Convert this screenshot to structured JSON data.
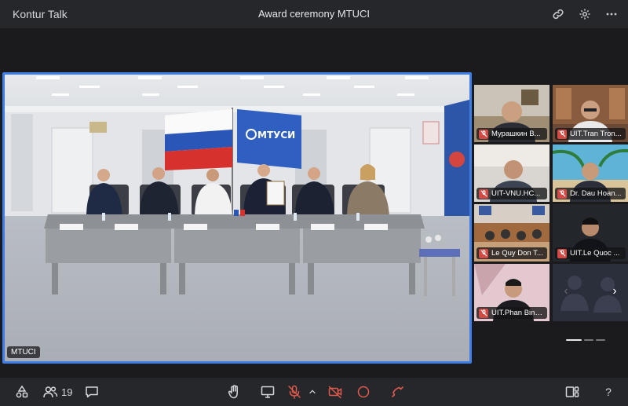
{
  "app": {
    "name": "Kontur Talk",
    "meeting_title": "Award ceremony MTUCI"
  },
  "main_video": {
    "label": "MTUCI",
    "flag_text": "МТУСИ"
  },
  "participants": [
    {
      "name": "Мурашкин В..."
    },
    {
      "name": "UIT.Tran Tron..."
    },
    {
      "name": "UIT-VNU.HC..."
    },
    {
      "name": "Dr. Dau Hoan..."
    },
    {
      "name": "Le Quy Don T..."
    },
    {
      "name": "UIT.Le Quoc ..."
    },
    {
      "name": "UIT.Phan Binh..."
    }
  ],
  "toolbar": {
    "participants_count": "19",
    "help_label": "?"
  },
  "colors": {
    "accent": "#3d7ee8",
    "muted": "#d24a44",
    "end_call": "#e05a4e",
    "background": "#1b1b1d",
    "bar": "#26272a"
  },
  "icons": {
    "title_bar": [
      "link-icon",
      "gear-icon",
      "more-icon"
    ],
    "toolbar": [
      "shapes-icon",
      "participants-icon",
      "chat-icon",
      "raise-hand-icon",
      "screen-share-icon",
      "mic-off-icon",
      "chevron-up-icon",
      "camera-off-icon",
      "record-icon",
      "end-call-icon",
      "layout-icon",
      "help-icon"
    ]
  }
}
